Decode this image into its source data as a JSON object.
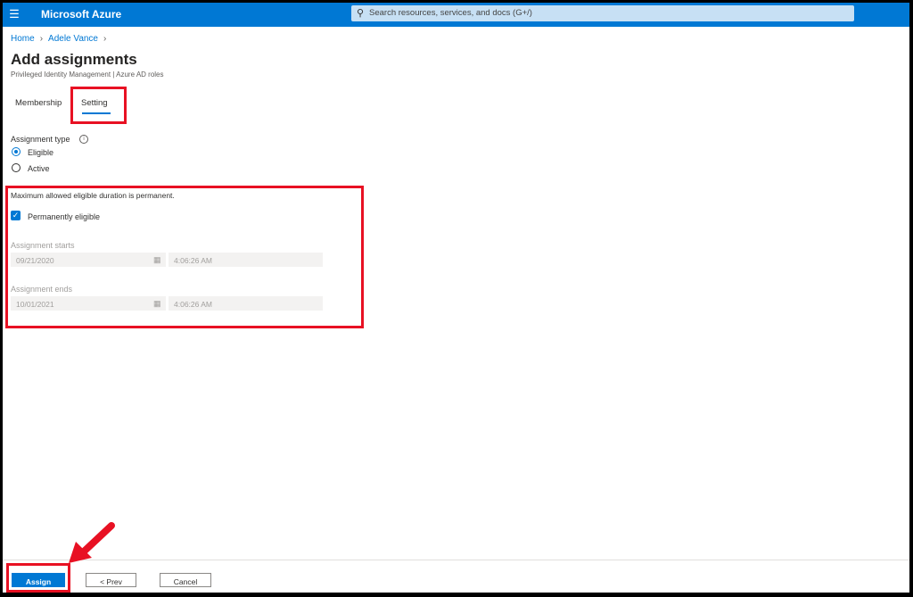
{
  "topbar": {
    "brand": "Microsoft Azure",
    "search_placeholder": "Search resources, services, and docs (G+/)"
  },
  "breadcrumb": [
    "Home",
    "Adele Vance"
  ],
  "page": {
    "title": "Add assignments",
    "subtitle": "Privileged Identity Management | Azure AD roles"
  },
  "tabs": [
    {
      "label": "Membership",
      "selected": false
    },
    {
      "label": "Setting",
      "selected": true
    }
  ],
  "assignment_type": {
    "label": "Assignment type",
    "options": [
      {
        "label": "Eligible",
        "selected": true
      },
      {
        "label": "Active",
        "selected": false
      }
    ]
  },
  "duration": {
    "note": "Maximum allowed eligible duration is permanent.",
    "permanently_eligible_label": "Permanently eligible",
    "permanently_eligible_checked": true,
    "starts": {
      "label": "Assignment starts",
      "date": "09/21/2020",
      "time": "4:06:26 AM"
    },
    "ends": {
      "label": "Assignment ends",
      "date": "10/01/2021",
      "time": "4:06:26 AM"
    }
  },
  "footer": {
    "assign": "Assign",
    "prev": "< Prev",
    "cancel": "Cancel"
  },
  "colors": {
    "accent": "#0078d4",
    "highlight": "#e81123"
  }
}
